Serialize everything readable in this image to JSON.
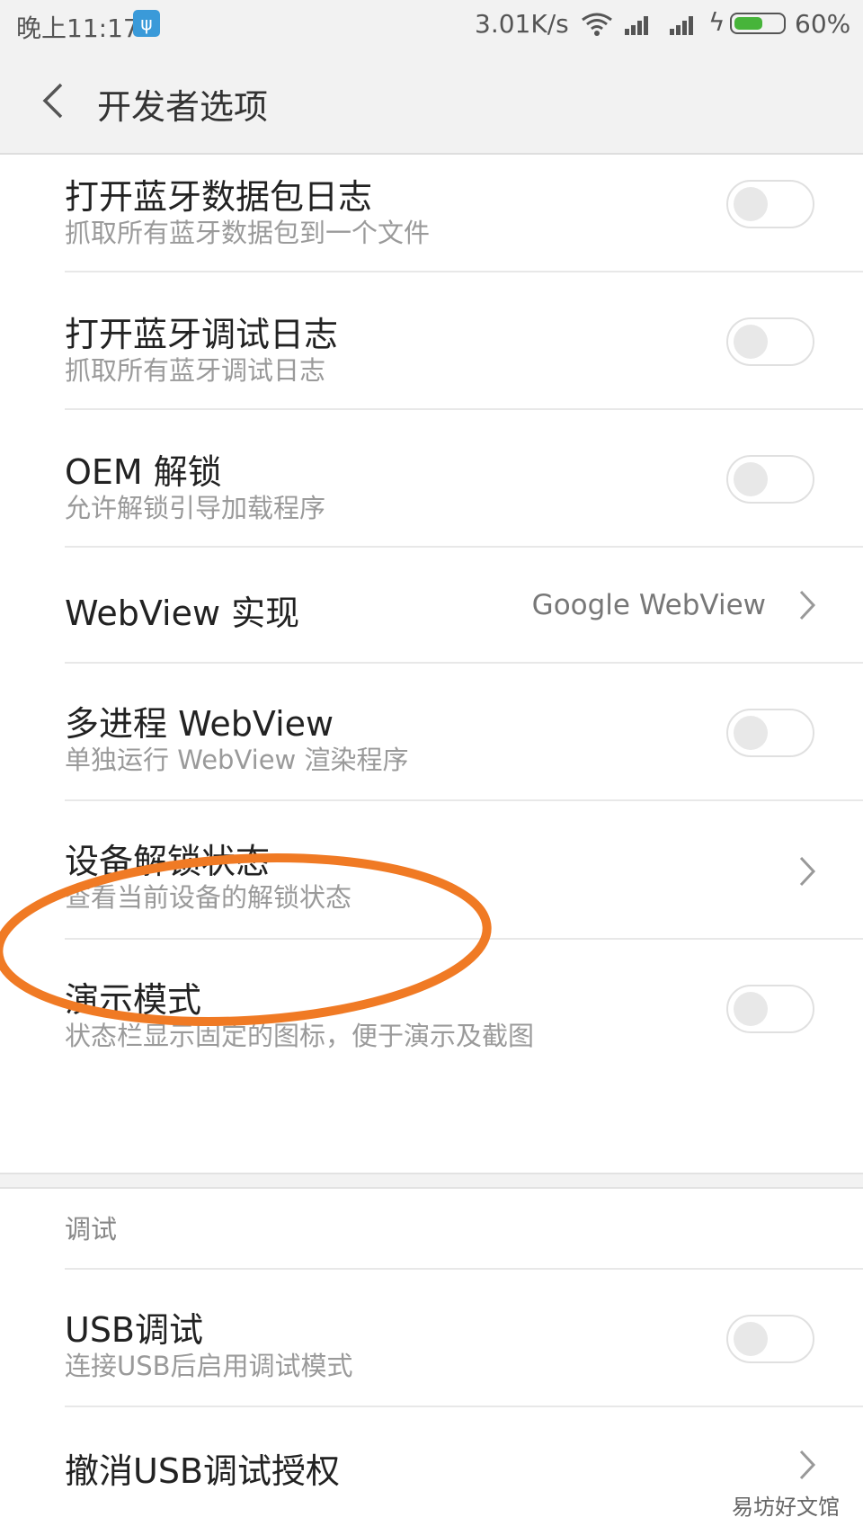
{
  "status_bar": {
    "time": "晚上11:17",
    "usb_icon": "usb-debug-icon",
    "network_speed": "3.01K/s",
    "battery_percent": "60%",
    "battery_level": 0.6,
    "battery_color": "#47b43a"
  },
  "app_bar": {
    "title": "开发者选项"
  },
  "settings": [
    {
      "title": "打开蓝牙数据包日志",
      "subtitle": "抓取所有蓝牙数据包到一个文件",
      "type": "toggle",
      "checked": false
    },
    {
      "title": "打开蓝牙调试日志",
      "subtitle": "抓取所有蓝牙调试日志",
      "type": "toggle",
      "checked": false
    },
    {
      "title": "OEM 解锁",
      "subtitle": "允许解锁引导加载程序",
      "type": "toggle",
      "checked": false
    },
    {
      "title": "WebView 实现",
      "value": "Google WebView",
      "type": "nav"
    },
    {
      "title": "多进程 WebView",
      "subtitle": "单独运行 WebView 渲染程序",
      "type": "toggle",
      "checked": false
    },
    {
      "title": "设备解锁状态",
      "subtitle": "查看当前设备的解锁状态",
      "type": "nav",
      "highlighted": true,
      "highlight_color": "#f07a24"
    },
    {
      "title": "演示模式",
      "subtitle": "状态栏显示固定的图标，便于演示及截图",
      "type": "toggle",
      "checked": false
    }
  ],
  "debug_section": {
    "header": "调试",
    "items": [
      {
        "title": "USB调试",
        "subtitle": "连接USB后启用调试模式",
        "type": "toggle",
        "checked": false
      },
      {
        "title": "撤消USB调试授权",
        "type": "nav"
      }
    ]
  },
  "watermark": "易坊好文馆"
}
